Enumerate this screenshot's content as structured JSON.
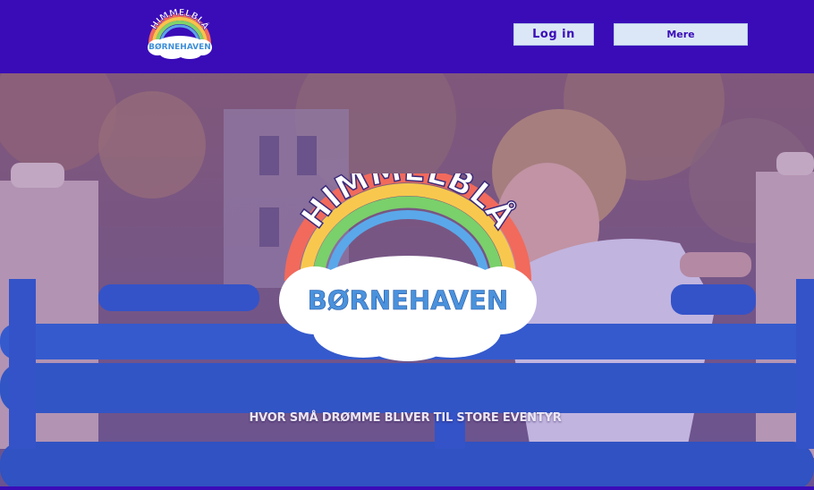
{
  "header": {
    "logo": {
      "top_text": "HIMMELBLÅ",
      "bottom_text": "BØRNEHAVEN"
    },
    "login_label": "Log in",
    "more_label": "Mere"
  },
  "hero": {
    "logo": {
      "top_text": "HIMMELBLÅ",
      "bottom_text": "BØRNEHAVEN"
    },
    "tagline": "HVOR SMÅ DRØMME BLIVER TIL STORE EVENTYR"
  },
  "colors": {
    "brand": "#3a0cb8",
    "button_bg": "#dbe7f6",
    "overlay": "#5a3aa8"
  }
}
